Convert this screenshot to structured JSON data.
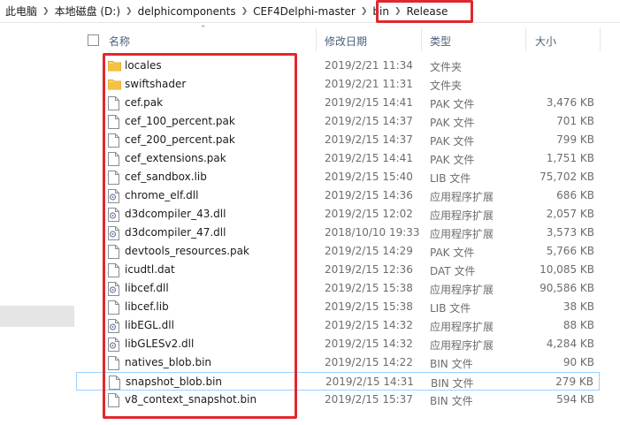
{
  "breadcrumb": [
    "此电脑",
    "本地磁盘 (D:)",
    "delphicomponents",
    "CEF4Delphi-master",
    "bin",
    "Release"
  ],
  "columns": {
    "name": "名称",
    "date": "修改日期",
    "type": "类型",
    "size": "大小"
  },
  "files": [
    {
      "name": "locales",
      "date": "2019/2/21 11:34",
      "type": "文件夹",
      "size": "",
      "icon": "folder-icon"
    },
    {
      "name": "swiftshader",
      "date": "2019/2/21 11:31",
      "type": "文件夹",
      "size": "",
      "icon": "folder-icon"
    },
    {
      "name": "cef.pak",
      "date": "2019/2/15 14:41",
      "type": "PAK 文件",
      "size": "3,476 KB",
      "icon": "file-icon"
    },
    {
      "name": "cef_100_percent.pak",
      "date": "2019/2/15 14:37",
      "type": "PAK 文件",
      "size": "701 KB",
      "icon": "file-icon"
    },
    {
      "name": "cef_200_percent.pak",
      "date": "2019/2/15 14:37",
      "type": "PAK 文件",
      "size": "799 KB",
      "icon": "file-icon"
    },
    {
      "name": "cef_extensions.pak",
      "date": "2019/2/15 14:41",
      "type": "PAK 文件",
      "size": "1,751 KB",
      "icon": "file-icon"
    },
    {
      "name": "cef_sandbox.lib",
      "date": "2019/2/15 15:40",
      "type": "LIB 文件",
      "size": "75,702 KB",
      "icon": "file-icon"
    },
    {
      "name": "chrome_elf.dll",
      "date": "2019/2/15 14:36",
      "type": "应用程序扩展",
      "size": "686 KB",
      "icon": "dll-icon"
    },
    {
      "name": "d3dcompiler_43.dll",
      "date": "2019/2/15 12:02",
      "type": "应用程序扩展",
      "size": "2,057 KB",
      "icon": "dll-icon"
    },
    {
      "name": "d3dcompiler_47.dll",
      "date": "2018/10/10 19:33",
      "type": "应用程序扩展",
      "size": "3,573 KB",
      "icon": "dll-icon"
    },
    {
      "name": "devtools_resources.pak",
      "date": "2019/2/15 14:29",
      "type": "PAK 文件",
      "size": "5,766 KB",
      "icon": "file-icon"
    },
    {
      "name": "icudtl.dat",
      "date": "2019/2/15 12:36",
      "type": "DAT 文件",
      "size": "10,085 KB",
      "icon": "file-icon"
    },
    {
      "name": "libcef.dll",
      "date": "2019/2/15 15:38",
      "type": "应用程序扩展",
      "size": "90,586 KB",
      "icon": "dll-icon"
    },
    {
      "name": "libcef.lib",
      "date": "2019/2/15 15:38",
      "type": "LIB 文件",
      "size": "38 KB",
      "icon": "file-icon"
    },
    {
      "name": "libEGL.dll",
      "date": "2019/2/15 14:32",
      "type": "应用程序扩展",
      "size": "88 KB",
      "icon": "dll-icon"
    },
    {
      "name": "libGLESv2.dll",
      "date": "2019/2/15 14:32",
      "type": "应用程序扩展",
      "size": "4,284 KB",
      "icon": "dll-icon"
    },
    {
      "name": "natives_blob.bin",
      "date": "2019/2/15 14:22",
      "type": "BIN 文件",
      "size": "90 KB",
      "icon": "file-icon"
    },
    {
      "name": "snapshot_blob.bin",
      "date": "2019/2/15 14:31",
      "type": "BIN 文件",
      "size": "279 KB",
      "icon": "file-icon",
      "hover": true
    },
    {
      "name": "v8_context_snapshot.bin",
      "date": "2019/2/15 15:37",
      "type": "BIN 文件",
      "size": "594 KB",
      "icon": "file-icon"
    }
  ],
  "colors": {
    "highlight": "#e0282d",
    "hover_border": "#99d1ff",
    "folder": "#f4c242"
  }
}
